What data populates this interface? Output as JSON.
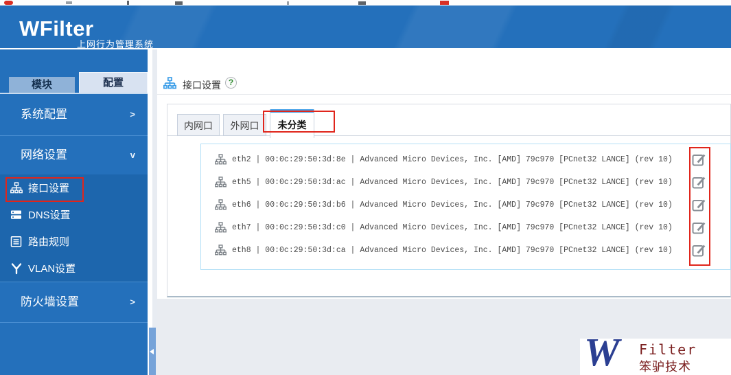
{
  "colors": {
    "header_blue": "#2470bb",
    "submenu_blue": "#1d66ad",
    "active_tab_bar": "#45a2e8",
    "annotation_red": "#e0251b",
    "logo_navy": "#2b3f92",
    "logo_maroon": "#7a1e1e"
  },
  "top_strip": {
    "icons": [
      "red-bookmark-icon",
      "gray-mark-icon",
      "bar-mark-icon",
      "dark-mark-icon",
      "thin-mark-icon",
      "dark-mark-icon-2",
      "red-mark-icon"
    ]
  },
  "header": {
    "brand": "WFilter",
    "subtitle": "上网行为管理系统"
  },
  "sidebar": {
    "tabs": [
      {
        "label": "模块",
        "active": false
      },
      {
        "label": "配置",
        "active": true
      }
    ],
    "sections": [
      {
        "label": "系统配置",
        "arrow": ">"
      },
      {
        "label": "网络设置",
        "arrow": "v",
        "expanded": true,
        "items": [
          {
            "label": "接口设置",
            "icon": "network-tree-icon",
            "selected": true,
            "annotated": true
          },
          {
            "label": "DNS设置",
            "icon": "dns-server-icon"
          },
          {
            "label": "路由规则",
            "icon": "route-rules-icon"
          },
          {
            "label": "VLAN设置",
            "icon": "vlan-icon"
          }
        ]
      },
      {
        "label": "防火墙设置",
        "arrow": ">"
      }
    ]
  },
  "breadcrumb": {
    "title": "接口设置",
    "help": "?"
  },
  "panel": {
    "tabs": [
      {
        "label": "内网口",
        "active": false
      },
      {
        "label": "外网口",
        "active": false
      },
      {
        "label": "未分类",
        "active": true
      }
    ],
    "separator": "|",
    "interfaces": [
      {
        "name": "eth2",
        "mac": "00:0c:29:50:3d:8e",
        "desc": "Advanced Micro Devices, Inc. [AMD] 79c970 [PCnet32 LANCE] (rev 10)"
      },
      {
        "name": "eth5",
        "mac": "00:0c:29:50:3d:ac",
        "desc": "Advanced Micro Devices, Inc. [AMD] 79c970 [PCnet32 LANCE] (rev 10)"
      },
      {
        "name": "eth6",
        "mac": "00:0c:29:50:3d:b6",
        "desc": "Advanced Micro Devices, Inc. [AMD] 79c970 [PCnet32 LANCE] (rev 10)"
      },
      {
        "name": "eth7",
        "mac": "00:0c:29:50:3d:c0",
        "desc": "Advanced Micro Devices, Inc. [AMD] 79c970 [PCnet32 LANCE] (rev 10)"
      },
      {
        "name": "eth8",
        "mac": "00:0c:29:50:3d:ca",
        "desc": "Advanced Micro Devices, Inc. [AMD] 79c970 [PCnet32 LANCE] (rev 10)"
      }
    ]
  },
  "footer_logo": {
    "w": "W",
    "name": "Filter",
    "caption": "笨驴技术"
  }
}
